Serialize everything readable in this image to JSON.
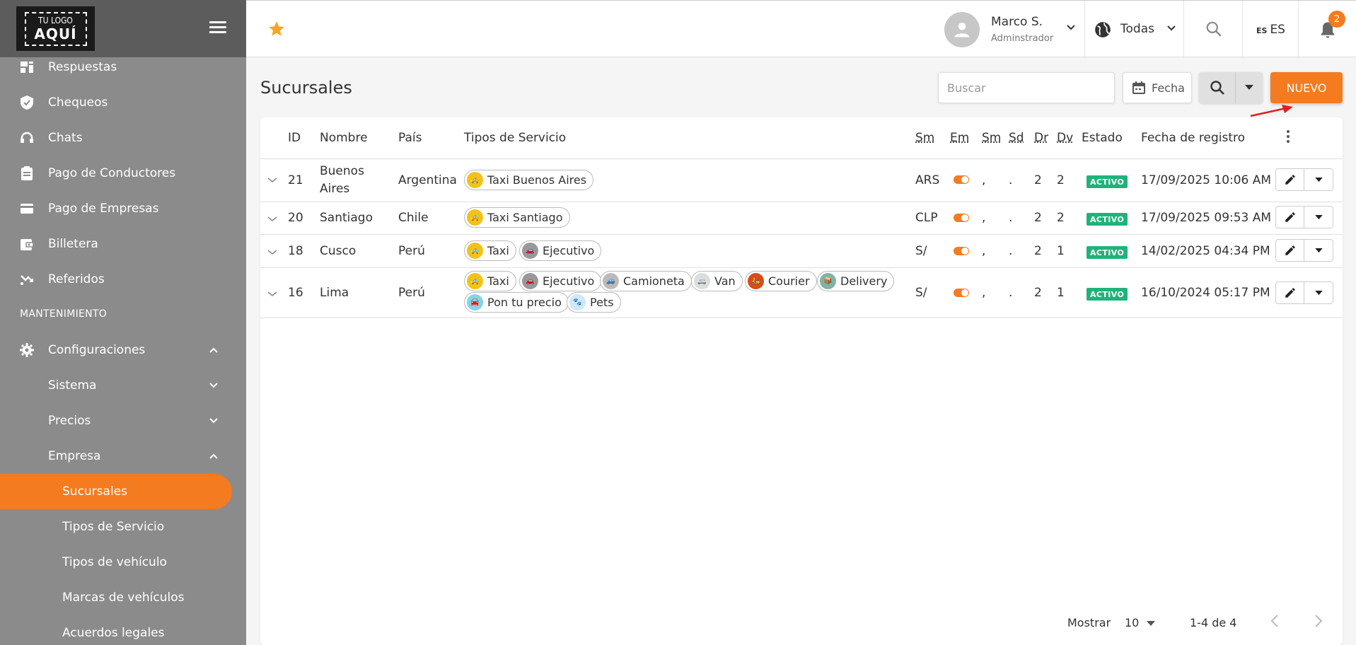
{
  "logo": {
    "line1": "TU LOGO",
    "line2": "AQUÍ"
  },
  "sidebar": {
    "items": [
      {
        "label": "Respuestas",
        "icon": "responses-icon"
      },
      {
        "label": "Chequeos",
        "icon": "shield-check-icon"
      },
      {
        "label": "Chats",
        "icon": "headset-icon"
      },
      {
        "label": "Pago de Conductores",
        "icon": "clipboard-icon"
      },
      {
        "label": "Pago de Empresas",
        "icon": "credit-card-icon"
      },
      {
        "label": "Billetera",
        "icon": "wallet-icon"
      },
      {
        "label": "Referidos",
        "icon": "referral-icon"
      }
    ],
    "section": "MANTENIMIENTO",
    "config": {
      "label": "Configuraciones"
    },
    "sub": [
      {
        "label": "Sistema"
      },
      {
        "label": "Precios"
      },
      {
        "label": "Empresa"
      }
    ],
    "sub2": [
      {
        "label": "Sucursales"
      },
      {
        "label": "Tipos de Servicio"
      },
      {
        "label": "Tipos de vehículo"
      },
      {
        "label": "Marcas de vehículos"
      },
      {
        "label": "Acuerdos legales"
      }
    ]
  },
  "topbar": {
    "user_name": "Marco S.",
    "user_role": "Adminstrador",
    "region": "Todas",
    "lang_code": "ES",
    "lang": "ES",
    "notifications": "2"
  },
  "page": {
    "title": "Sucursales",
    "search_placeholder": "Buscar",
    "date_label": "Fecha",
    "new_label": "NUEVO"
  },
  "table": {
    "headers": {
      "id": "ID",
      "nombre": "Nombre",
      "pais": "País",
      "tipos": "Tipos de Servicio",
      "sm": "Sm",
      "em": "Em",
      "sm2": "Sm",
      "sd": "Sd",
      "dr": "Dr",
      "dv": "Dv",
      "estado": "Estado",
      "fecha": "Fecha de registro"
    },
    "rows": [
      {
        "id": "21",
        "nombre1": "Buenos",
        "nombre2": "Aires",
        "pais": "Argentina",
        "services": [
          "Taxi Buenos Aires"
        ],
        "sm": "ARS",
        "sm2": ",",
        "sd": ".",
        "dr": "2",
        "dv": "2",
        "estado": "ACTIVO",
        "fecha": "17/09/2025 10:06 AM"
      },
      {
        "id": "20",
        "nombre": "Santiago",
        "pais": "Chile",
        "services": [
          "Taxi Santiago"
        ],
        "sm": "CLP",
        "sm2": ",",
        "sd": ".",
        "dr": "2",
        "dv": "2",
        "estado": "ACTIVO",
        "fecha": "17/09/2025 09:53 AM"
      },
      {
        "id": "18",
        "nombre": "Cusco",
        "pais": "Perú",
        "services": [
          "Taxi",
          "Ejecutivo"
        ],
        "sm": "S/",
        "sm2": ",",
        "sd": ".",
        "dr": "2",
        "dv": "1",
        "estado": "ACTIVO",
        "fecha": "14/02/2025 04:34 PM"
      },
      {
        "id": "16",
        "nombre": "Lima",
        "pais": "Perú",
        "services": [
          "Taxi",
          "Ejecutivo",
          "Camioneta",
          "Van",
          "Courier",
          "Delivery",
          "Pon tu precio",
          "Pets"
        ],
        "sm": "S/",
        "sm2": ",",
        "sd": ".",
        "dr": "2",
        "dv": "1",
        "estado": "ACTIVO",
        "fecha": "16/10/2024 05:17 PM"
      }
    ]
  },
  "pagination": {
    "show_label": "Mostrar",
    "per_page": "10",
    "range": "1-4 de 4"
  },
  "colors": {
    "accent": "#f47b20",
    "sidebar": "#8b8b8b",
    "active_badge": "#1fb37a"
  }
}
